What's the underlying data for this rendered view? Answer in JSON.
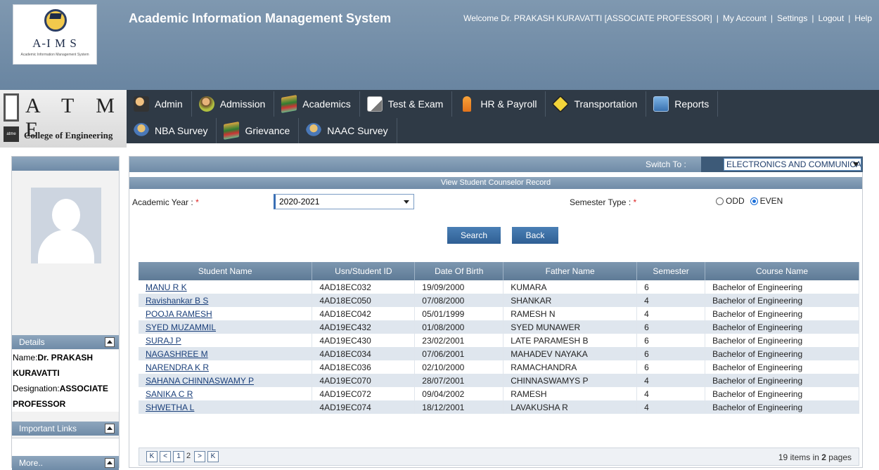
{
  "header": {
    "logo_text": "A-I M S",
    "logo_sub": "Academic Information Management System",
    "app_title": "Academic Information Management System",
    "welcome": "Welcome Dr. PRAKASH KURAVATTI [ASSOCIATE PROFESSOR]",
    "links": [
      "My Account",
      "Settings",
      "Logout",
      "Help"
    ],
    "college_big": "A T M E",
    "college_name": "College of Engineering",
    "college_small_logo": "atme"
  },
  "nav": {
    "row1": [
      {
        "label": "Admin",
        "icon": "admin-icon"
      },
      {
        "label": "Admission",
        "icon": "admission-icon"
      },
      {
        "label": "Academics",
        "icon": "academics-icon"
      },
      {
        "label": "Test & Exam",
        "icon": "test-exam-icon"
      },
      {
        "label": "HR & Payroll",
        "icon": "hr-payroll-icon"
      },
      {
        "label": "Transportation",
        "icon": "transportation-icon"
      },
      {
        "label": "Reports",
        "icon": "reports-icon"
      }
    ],
    "row2": [
      {
        "label": "NBA Survey",
        "icon": "nba-survey-icon"
      },
      {
        "label": "Grievance",
        "icon": "grievance-icon"
      },
      {
        "label": "NAAC Survey",
        "icon": "naac-survey-icon"
      }
    ]
  },
  "sidebar": {
    "details_title": "Details",
    "name_label": "Name:",
    "name_value": "Dr. PRAKASH KURAVATTI",
    "designation_label": "Designation:",
    "designation_value": "ASSOCIATE PROFESSOR",
    "important_links_title": "Important Links",
    "more_title": "More.."
  },
  "main": {
    "switch_label": "Switch To :",
    "switch_value": "ELECTRONICS AND COMMUNICA",
    "section_title": "View Student Counselor Record",
    "academic_year_label": "Academic Year :",
    "academic_year_value": "2020-2021",
    "semester_type_label": "Semester Type :",
    "required_mark": "*",
    "radio_odd": "ODD",
    "radio_even": "EVEN",
    "semester_selected": "EVEN",
    "search_label": "Search",
    "back_label": "Back"
  },
  "grid": {
    "columns": [
      "Student Name",
      "Usn/Student ID",
      "Date Of Birth",
      "Father Name",
      "Semester",
      "Course Name"
    ],
    "rows": [
      [
        "MANU R K",
        "4AD18EC032",
        "19/09/2000",
        "KUMARA",
        "6",
        "Bachelor of Engineering"
      ],
      [
        "Ravishankar B S",
        "4AD18EC050",
        "07/08/2000",
        "SHANKAR",
        "4",
        "Bachelor of Engineering"
      ],
      [
        "POOJA RAMESH",
        "4AD18EC042",
        "05/01/1999",
        "RAMESH N",
        "4",
        "Bachelor of Engineering"
      ],
      [
        "SYED MUZAMMIL",
        "4AD19EC432",
        "01/08/2000",
        "SYED MUNAWER",
        "6",
        "Bachelor of Engineering"
      ],
      [
        "SURAJ P",
        "4AD19EC430",
        "23/02/2001",
        "LATE PARAMESH B",
        "6",
        "Bachelor of Engineering"
      ],
      [
        "NAGASHREE M",
        "4AD18EC034",
        "07/06/2001",
        "MAHADEV NAYAKA",
        "6",
        "Bachelor of Engineering"
      ],
      [
        "NARENDRA K R",
        "4AD18EC036",
        "02/10/2000",
        "RAMACHANDRA",
        "6",
        "Bachelor of Engineering"
      ],
      [
        "SAHANA CHINNASWAMY P",
        "4AD19EC070",
        "28/07/2001",
        "CHINNASWAMYS P",
        "4",
        "Bachelor of Engineering"
      ],
      [
        "SANIKA C R",
        "4AD19EC072",
        "09/04/2002",
        "RAMESH",
        "4",
        "Bachelor of Engineering"
      ],
      [
        "SHWETHA L",
        "4AD19EC074",
        "18/12/2001",
        "LAVAKUSHA R",
        "4",
        "Bachelor of Engineering"
      ]
    ],
    "pager": {
      "first": "K",
      "prev": "<",
      "page_1": "1",
      "current_page": "2",
      "next": ">",
      "last": "K",
      "total_items": "19",
      "items_text": "items in",
      "total_pages": "2",
      "pages_text": "pages"
    }
  },
  "colors": {
    "header_band": "#6985a1",
    "nav_bg": "#2f3a46",
    "grid_header": "#5e7a96",
    "link": "#1a3f7a",
    "accent_button": "#2f5f94"
  }
}
